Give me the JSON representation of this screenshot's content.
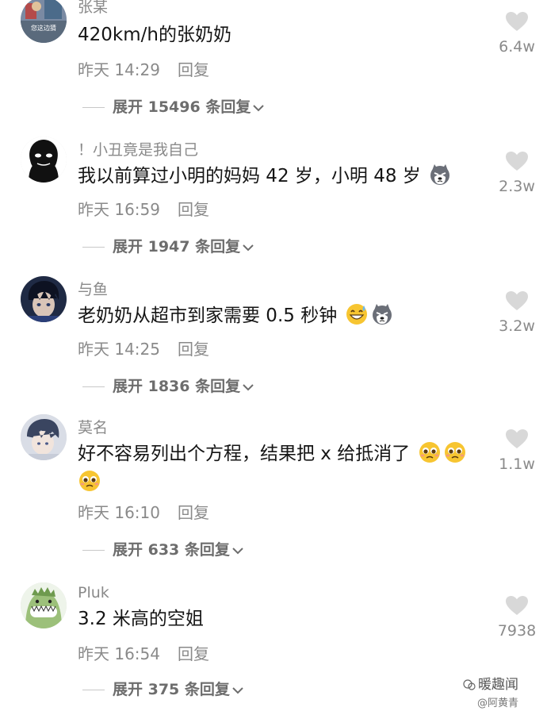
{
  "comments": [
    {
      "username": "张某",
      "avatar_overlay": "您这边猜",
      "text": "420km/h的张奶奶",
      "time": "昨天 14:29",
      "reply": "回复",
      "likes": "6.4w",
      "expand": "展开 15496 条回复"
    },
    {
      "username": "！小丑竟是我自己",
      "text": "我以前算过小明的妈妈 42 岁，小明 48 岁",
      "emojis": [
        "husky-emoji"
      ],
      "time": "昨天 16:59",
      "reply": "回复",
      "likes": "2.3w",
      "expand": "展开 1947 条回复"
    },
    {
      "username": "与鱼",
      "text": "老奶奶从超市到家需要 0.5 秒钟",
      "emojis": [
        "sweat-smile-emoji",
        "husky-emoji"
      ],
      "time": "昨天 14:25",
      "reply": "回复",
      "likes": "3.2w",
      "expand": "展开 1836 条回复"
    },
    {
      "username": "莫名",
      "text": "好不容易列出个方程，结果把 x 给抵消了",
      "emojis": [
        "pleading-emoji",
        "pleading-emoji",
        "pleading-emoji"
      ],
      "time": "昨天 16:10",
      "reply": "回复",
      "likes": "1.1w",
      "expand": "展开 633 条回复"
    },
    {
      "username": "Pluk",
      "text": "3.2 米高的空姐",
      "time": "昨天 16:54",
      "reply": "回复",
      "likes": "7938",
      "expand": "展开 375 条回复"
    }
  ],
  "watermark": {
    "line1": "暖趣闻",
    "line2": "@阿黄青"
  },
  "colors": {
    "secondary_text": "#8a8a8a",
    "heart": "#d8d8d8"
  }
}
